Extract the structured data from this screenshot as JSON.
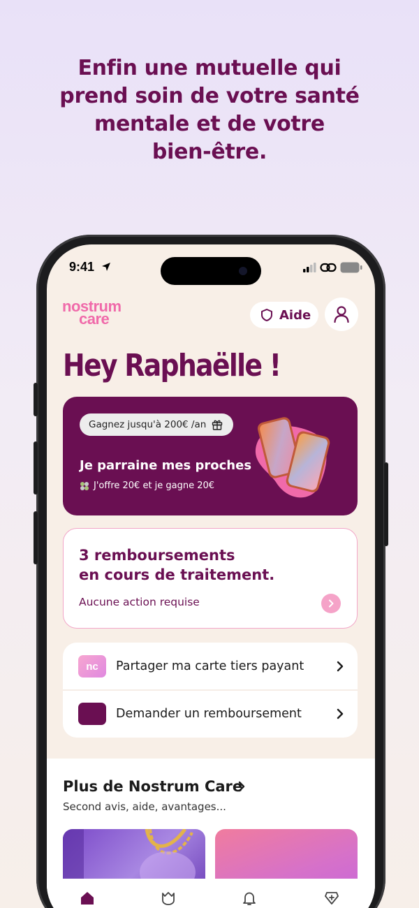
{
  "headline": {
    "line1": "Enfin une mutuelle qui",
    "line2": "prend soin de votre santé",
    "line3": "mentale et de votre",
    "line4": "bien-être."
  },
  "status_bar": {
    "time": "9:41"
  },
  "header": {
    "logo_line1": "nostrum",
    "logo_line2": "care",
    "help_label": "Aide"
  },
  "greeting": "Hey Raphaëlle !",
  "referral": {
    "pill": "Gagnez jusqu'à 200€ /an",
    "title": "Je parraine mes proches",
    "subtitle": "J'offre 20€ et je gagne 20€"
  },
  "reimbursements": {
    "title_line1": "3 remboursements",
    "title_line2": "en cours de traitement.",
    "status": "Aucune action requise"
  },
  "actions": [
    {
      "label": "Partager ma carte tiers payant",
      "icon": "tiers-payant-card-icon"
    },
    {
      "label": "Demander un remboursement",
      "icon": "reimbursement-request-icon"
    }
  ],
  "more": {
    "title": "Plus de Nostrum Care",
    "subtitle": "Second avis, aide, avantages..."
  },
  "tabbar": [
    "home-icon",
    "wellbeing-icon",
    "bell-icon",
    "perks-icon"
  ],
  "colors": {
    "brand": "#6a0f52",
    "pink": "#f06aaa",
    "background": "#f8efe7"
  }
}
